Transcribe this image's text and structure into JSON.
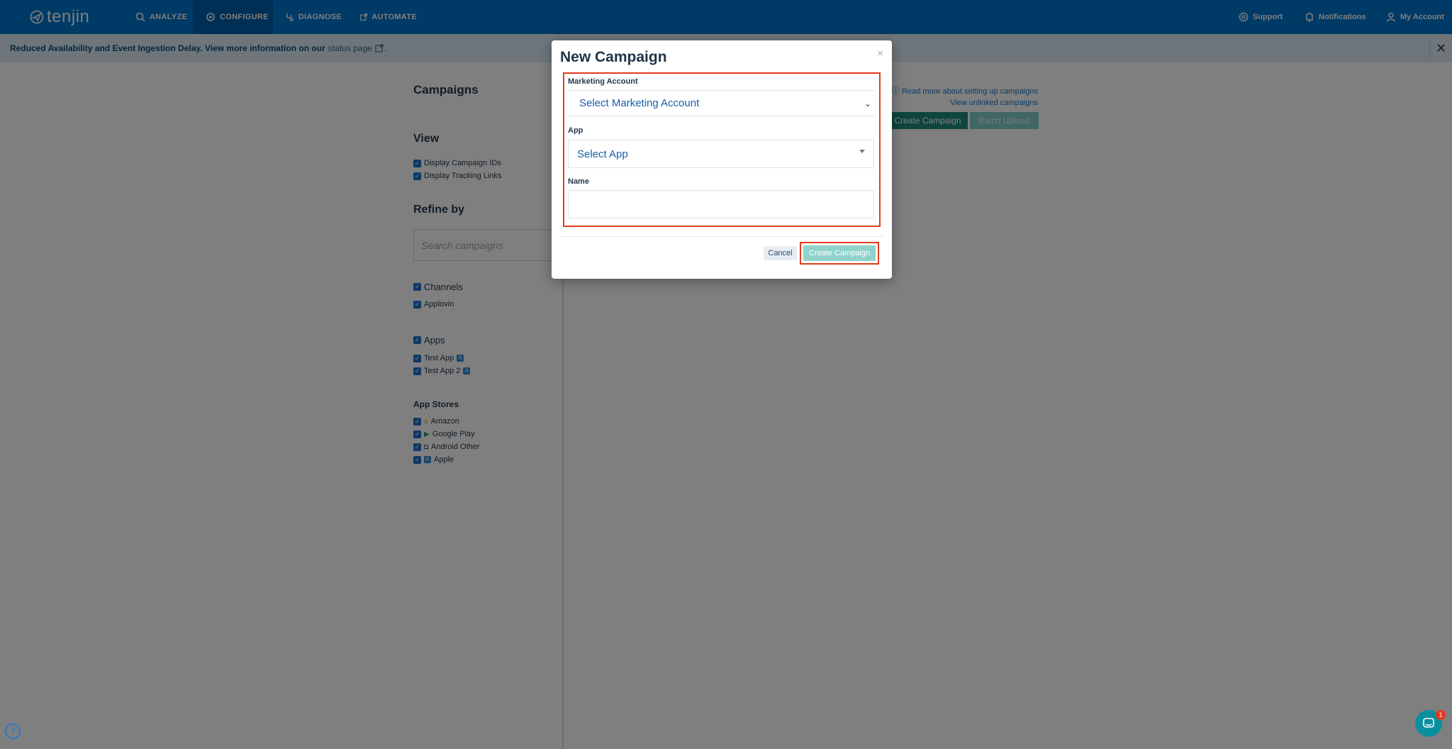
{
  "nav": {
    "logo": "tenjin",
    "items": [
      {
        "label": "ANALYZE",
        "icon": "analyze-icon"
      },
      {
        "label": "CONFIGURE",
        "icon": "configure-icon",
        "active": true
      },
      {
        "label": "DIAGNOSE",
        "icon": "diagnose-icon"
      },
      {
        "label": "AUTOMATE",
        "icon": "automate-icon"
      }
    ],
    "right": [
      {
        "label": "Support",
        "icon": "support-icon"
      },
      {
        "label": "Notifications",
        "icon": "notifications-icon"
      },
      {
        "label": "My Account",
        "icon": "user-icon"
      }
    ]
  },
  "banner": {
    "text": "Reduced Availability and Event Ingestion Delay. View more information on our",
    "link": "status page",
    "close": "✕"
  },
  "page": {
    "title": "Campaigns",
    "view_heading": "View",
    "view_options": [
      "Display Campaign IDs",
      "Display Tracking Links"
    ],
    "refine_heading": "Refine by",
    "search_placeholder": "Search campaigns",
    "channels_heading": "Channels",
    "channels": [
      "Applovin"
    ],
    "apps_heading": "Apps",
    "apps": [
      "Test App",
      "Test App 2"
    ],
    "stores_heading": "App Stores",
    "stores": [
      "Amazon",
      "Google Play",
      "Android Other",
      "Apple"
    ],
    "read_more": "Read more about setting up campaigns",
    "view_unlinked": "View unlinked campaigns",
    "create_campaign": "Create Campaign",
    "batch_upload": "Batch Upload"
  },
  "modal": {
    "title": "New Campaign",
    "close": "×",
    "marketing_label": "Marketing Account",
    "marketing_placeholder": "Select Marketing Account",
    "app_label": "App",
    "app_placeholder": "Select App",
    "name_label": "Name",
    "cancel": "Cancel",
    "create": "Create Campaign"
  },
  "chat": {
    "badge": "1"
  },
  "colors": {
    "nav": "#0074cc",
    "accent": "#1d8a7b",
    "highlight": "#e23a1e"
  }
}
